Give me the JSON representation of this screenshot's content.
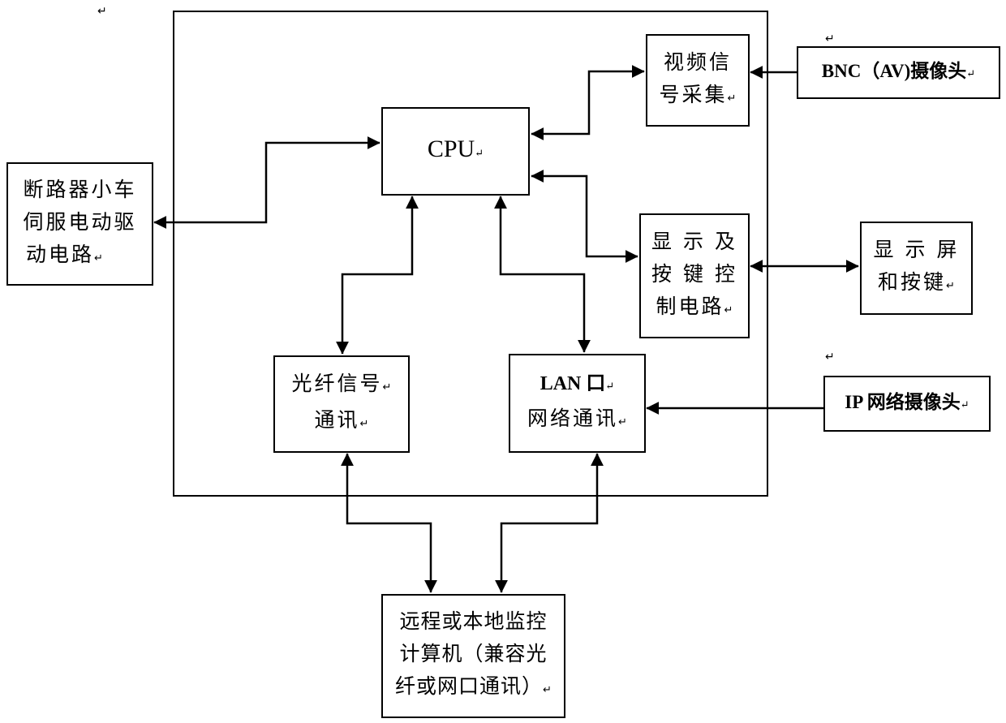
{
  "diagram": {
    "type": "block-diagram",
    "paragraph_mark": "↵",
    "blocks": {
      "cpu": {
        "lines": [
          "CPU"
        ]
      },
      "video_capture": {
        "lines": [
          "视频信",
          "号采集"
        ]
      },
      "bnc_camera": {
        "lines": [
          "BNC（AV)摄像头"
        ]
      },
      "display_control": {
        "lines": [
          "显 示 及",
          "按 键 控",
          "制电路"
        ]
      },
      "display_screen": {
        "lines": [
          "显 示 屏",
          "和按键"
        ]
      },
      "fiber_comm": {
        "lines": [
          "光纤信号",
          "通讯"
        ]
      },
      "lan_comm": {
        "lines": [
          "LAN 口",
          "网络通讯"
        ]
      },
      "ip_camera": {
        "lines": [
          "IP 网络摄像头"
        ]
      },
      "breaker_drive": {
        "lines": [
          "断路器小车",
          "伺服电动驱",
          "动电路"
        ]
      },
      "monitor_computer": {
        "lines": [
          "远程或本地监控",
          "计算机（兼容光",
          "纤或网口通讯）"
        ]
      }
    },
    "connections": [
      {
        "from": "cpu",
        "to": "breaker_drive",
        "direction": "bidirectional"
      },
      {
        "from": "cpu",
        "to": "video_capture",
        "direction": "bidirectional"
      },
      {
        "from": "bnc_camera",
        "to": "video_capture",
        "direction": "one-way"
      },
      {
        "from": "cpu",
        "to": "display_control",
        "direction": "bidirectional"
      },
      {
        "from": "display_control",
        "to": "display_screen",
        "direction": "bidirectional"
      },
      {
        "from": "cpu",
        "to": "fiber_comm",
        "direction": "bidirectional"
      },
      {
        "from": "cpu",
        "to": "lan_comm",
        "direction": "bidirectional"
      },
      {
        "from": "ip_camera",
        "to": "lan_comm",
        "direction": "one-way"
      },
      {
        "from": "fiber_comm",
        "to": "monitor_computer",
        "direction": "bidirectional"
      },
      {
        "from": "lan_comm",
        "to": "monitor_computer",
        "direction": "bidirectional"
      }
    ]
  }
}
